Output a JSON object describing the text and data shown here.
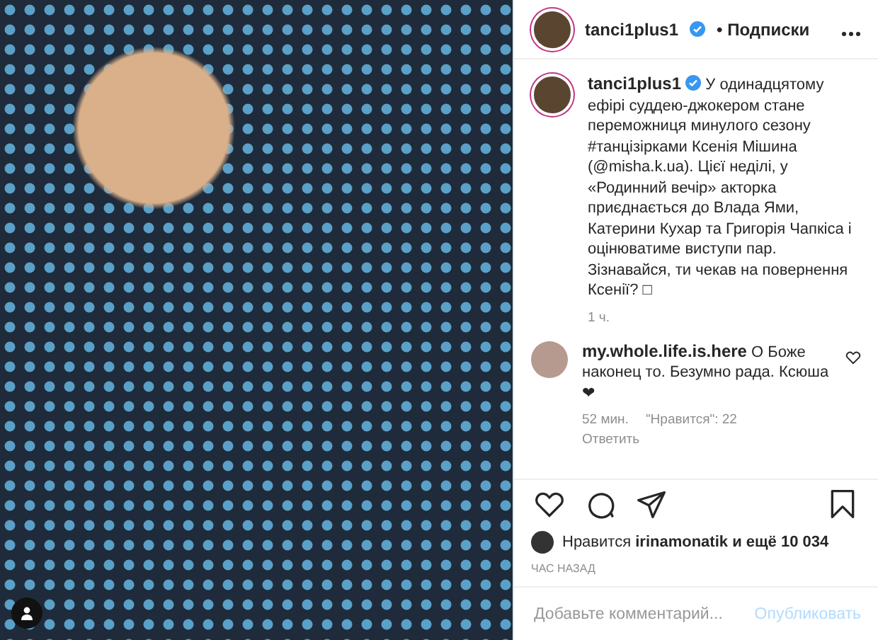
{
  "post": {
    "username": "tanci1plus1",
    "verified": true,
    "separator": "•",
    "follow_status": "Подписки",
    "tagged_people": true
  },
  "caption": {
    "username": "tanci1plus1",
    "verified": true,
    "text": "У одинадцятому ефірі суддею-джокером стане переможниця минулого сезону #танцізірками Ксенія Мішина (@misha.k.ua). Цієї неділі, у «Родинний вечір» акторка приєднається до Влада Ями, Катерини Кухар та Григорія Чапкіса і оцінюватиме виступи пар. Зізнавайся, ти чекав на повернення Ксенії? □",
    "time": "1 ч."
  },
  "comments": [
    {
      "username": "my.whole.life.is.here",
      "text": "О Боже наконец то. Безумно рада. Ксюша ❤",
      "time": "52 мин.",
      "likes": "\"Нравится\": 22",
      "reply": "Ответить",
      "liked": false
    }
  ],
  "actions": {
    "liked": false,
    "saved": false
  },
  "likes": {
    "prefix": "Нравится",
    "user": "irinamonatik",
    "suffix": "и ещё 10 034"
  },
  "posted": "ЧАС НАЗАД",
  "comment_field": {
    "placeholder": "Добавьте комментарий...",
    "submit": "Опубликовать"
  }
}
